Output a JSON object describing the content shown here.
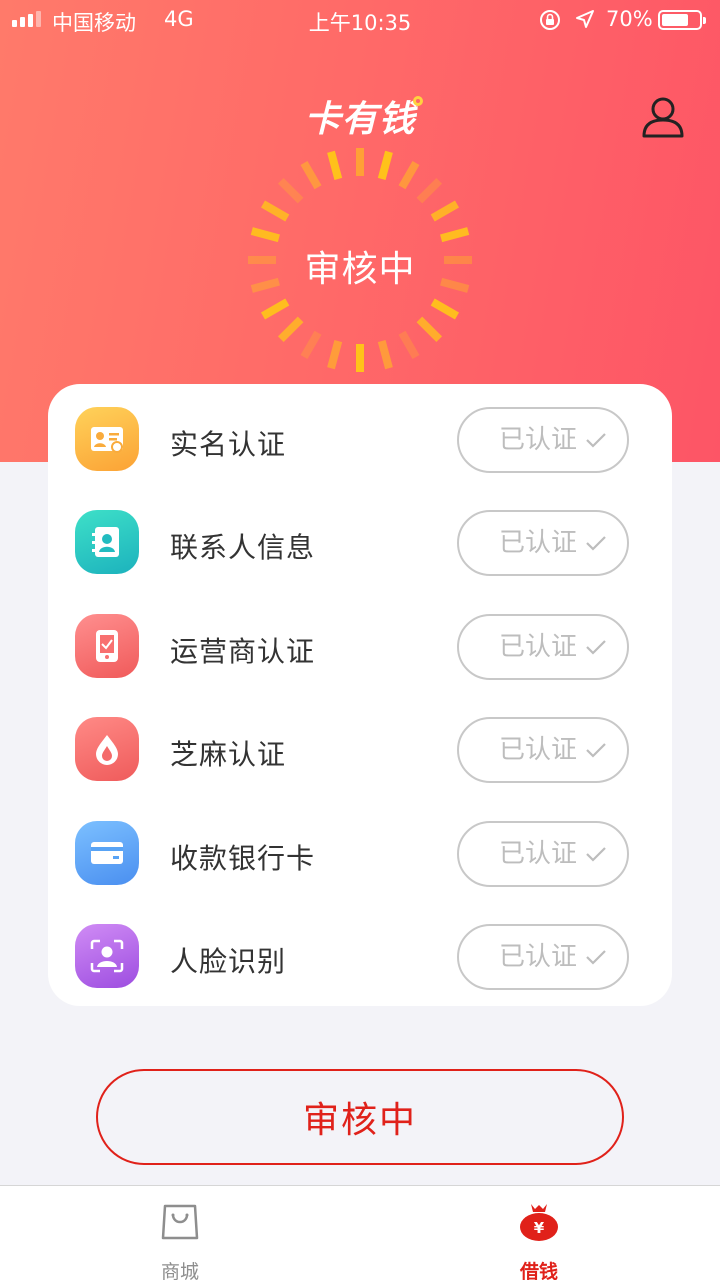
{
  "status_bar": {
    "carrier": "中国移动",
    "network": "4G",
    "time": "上午10:35",
    "battery": "70%",
    "battery_level": 0.7
  },
  "header": {
    "logo": "卡有钱",
    "user_icon": "user-icon"
  },
  "review": {
    "status": "审核中"
  },
  "verification_items": [
    {
      "label": "实名认证",
      "status": "已认证",
      "icon": "id-card-icon",
      "color": "#fdb54a"
    },
    {
      "label": "联系人信息",
      "status": "已认证",
      "icon": "contacts-icon",
      "color": "#2cc6c1"
    },
    {
      "label": "运营商认证",
      "status": "已认证",
      "icon": "phone-carrier-icon",
      "color": "#f87070"
    },
    {
      "label": "芝麻认证",
      "status": "已认证",
      "icon": "sesame-icon",
      "color": "#f46a6a"
    },
    {
      "label": "收款银行卡",
      "status": "已认证",
      "icon": "bank-card-icon",
      "color": "#58a3f5"
    },
    {
      "label": "人脸识别",
      "status": "已认证",
      "icon": "face-scan-icon",
      "color": "#b566e6"
    }
  ],
  "submit_button": {
    "label": "审核中"
  },
  "tabbar": {
    "tabs": [
      {
        "label": "商城",
        "icon": "shopping-bag-icon",
        "active": false
      },
      {
        "label": "借钱",
        "icon": "money-bag-icon",
        "active": true
      }
    ]
  },
  "colors": {
    "accent": "#e0211a",
    "header_start": "#ff7a6a",
    "header_end": "#fd5566",
    "spinner": "#ffc21a"
  }
}
